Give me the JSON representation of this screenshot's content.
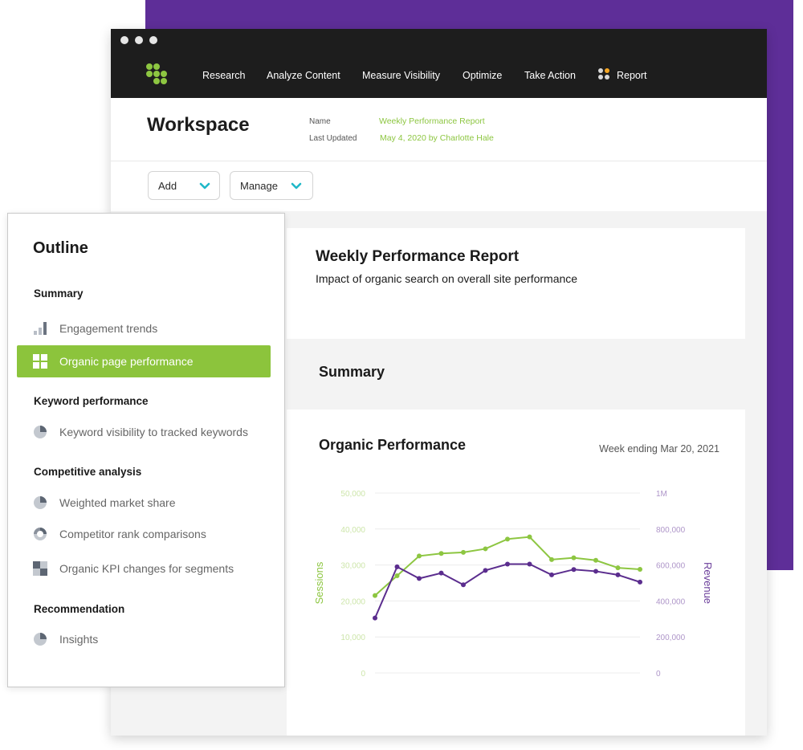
{
  "nav": {
    "items": [
      "Research",
      "Analyze Content",
      "Measure Visibility",
      "Optimize",
      "Take Action"
    ],
    "report_label": "Report"
  },
  "workspace": {
    "title": "Workspace",
    "name_label": "Name",
    "name_value": "Weekly Performance Report",
    "updated_label": "Last Updated",
    "updated_value": "May 4, 2020 by Charlotte Hale"
  },
  "actions": {
    "add_label": "Add",
    "manage_label": "Manage"
  },
  "report": {
    "title": "Weekly Performance Report",
    "subtitle": "Impact of organic search on overall site performance",
    "summary_label": "Summary"
  },
  "chart_card": {
    "title": "Organic Performance",
    "date": "Week ending Mar 20, 2021"
  },
  "chart_data": {
    "type": "line",
    "x": [
      1,
      2,
      3,
      4,
      5,
      6,
      7,
      8,
      9,
      10,
      11,
      12,
      13,
      14
    ],
    "series": [
      {
        "name": "Sessions",
        "axis": "left",
        "color": "#8dc641",
        "values": [
          21500,
          27000,
          32500,
          33200,
          33500,
          34500,
          37200,
          37800,
          31500,
          32000,
          31300,
          29200,
          28800
        ]
      },
      {
        "name": "Revenue",
        "axis": "right",
        "color": "#5b2d8e",
        "values": [
          305000,
          590000,
          525000,
          555000,
          490000,
          570000,
          605000,
          605000,
          545000,
          575000,
          565000,
          545000,
          505000
        ]
      }
    ],
    "ylabel_left": "Sessions",
    "ylabel_right": "Revenue",
    "ylim_left": [
      0,
      50000
    ],
    "ylim_right": [
      0,
      1000000
    ],
    "yticks_left": [
      "0",
      "10,000",
      "20,000",
      "30,000",
      "40,000",
      "50,000"
    ],
    "yticks_right": [
      "0",
      "200,000",
      "400,000",
      "600,000",
      "800,000",
      "1M"
    ],
    "grid": true,
    "left_color": "#8dc641",
    "right_color": "#6a3d9a"
  },
  "outline": {
    "title": "Outline",
    "sections": [
      {
        "heading": "Summary",
        "items": [
          {
            "label": "Engagement trends",
            "icon": "bar-chart-icon"
          },
          {
            "label": "Organic page performance",
            "icon": "grid-icon",
            "active": true
          }
        ]
      },
      {
        "heading": "Keyword performance",
        "items": [
          {
            "label": "Keyword visibility to tracked keywords",
            "icon": "pie-chart-icon"
          }
        ]
      },
      {
        "heading": "Competitive analysis",
        "items": [
          {
            "label": "Weighted market share",
            "icon": "pie-chart-icon"
          },
          {
            "label": "Competitor rank comparisons",
            "icon": "donut-chart-icon"
          },
          {
            "label": "Organic KPI changes for segments",
            "icon": "heatmap-icon"
          }
        ]
      },
      {
        "heading": "Recommendation",
        "items": [
          {
            "label": "Insights",
            "icon": "pie-chart-icon"
          }
        ]
      }
    ]
  },
  "colors": {
    "accent_green": "#8dc641",
    "brand_purple": "#5e2e98",
    "dropdown_chevron": "#20b8c8"
  }
}
